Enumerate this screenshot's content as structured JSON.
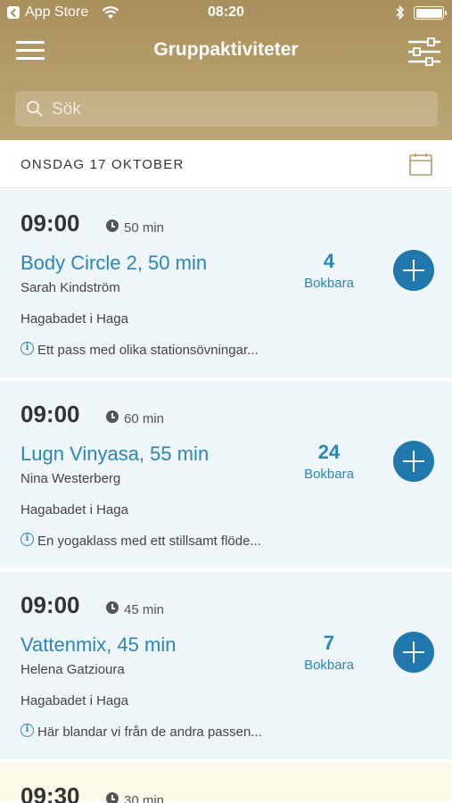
{
  "status_bar": {
    "back_app": "App Store",
    "time": "08:20"
  },
  "header": {
    "title": "Gruppaktiviteter",
    "menu_icon": "hamburger-menu-icon",
    "filter_icon": "sliders-filter-icon",
    "background_color": "#b39b68"
  },
  "search": {
    "placeholder": "Sök"
  },
  "date_bar": {
    "label": "ONSDAG 17 OKTOBER",
    "calendar_icon": "calendar-icon"
  },
  "activities": [
    {
      "time": "09:00",
      "duration": "50 min",
      "name": "Body Circle 2, 50 min",
      "instructor": "Sarah Kindström",
      "location": "Hagabadet i Haga",
      "description": "Ett pass med olika stationsövningar...",
      "spots": "4",
      "spots_label": "Bokbara"
    },
    {
      "time": "09:00",
      "duration": "60 min",
      "name": "Lugn Vinyasa, 55 min",
      "instructor": "Nina Westerberg",
      "location": "Hagabadet i Haga",
      "description": "En yogaklass med ett stillsamt flöde...",
      "spots": "24",
      "spots_label": "Bokbara"
    },
    {
      "time": "09:00",
      "duration": "45 min",
      "name": "Vattenmix, 45 min",
      "instructor": "Helena Gatzioura",
      "location": "Hagabadet i Haga",
      "description": "Här blandar vi från de andra passen...",
      "spots": "7",
      "spots_label": "Bokbara"
    },
    {
      "time": "09:30",
      "duration": "30 min"
    }
  ],
  "colors": {
    "accent": "#2a86b8",
    "add_button": "#2078ad",
    "card_background": "#eef6fa",
    "card_background_highlight": "#fbf9e8"
  }
}
